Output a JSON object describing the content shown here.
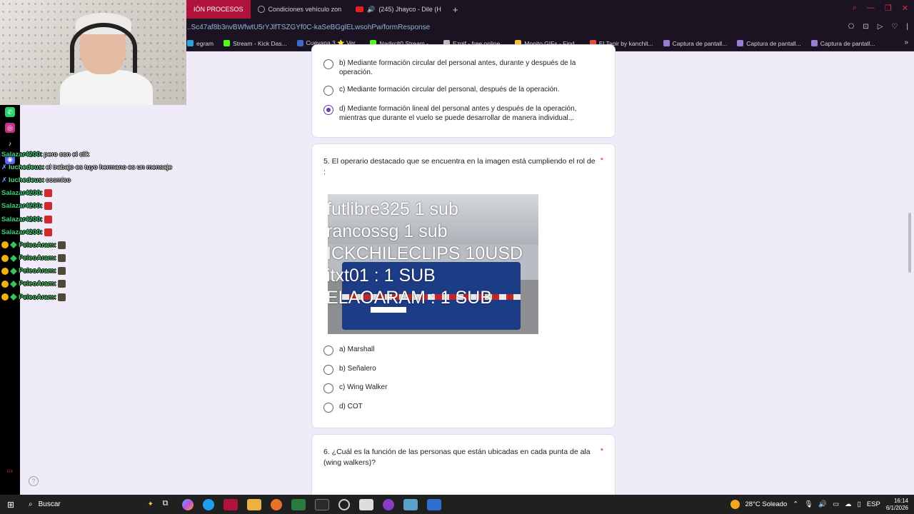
{
  "browser": {
    "tabs": [
      {
        "label": "IÓN PROCESOS",
        "active": true
      },
      {
        "label": "Condiciones vehículo zon",
        "active": false
      },
      {
        "label": "(245) Jhayco - Dile (H",
        "active": false
      }
    ],
    "new_tab": "+",
    "url": "..Sc47af8b3nvBWfwtU5rYJlfTSZGYf0C-kaSeBGglELwsohPw/formResponse",
    "bookmarks": [
      {
        "label": "egram",
        "color": "#2aa3df"
      },
      {
        "label": "Stream - Kick Das...",
        "color": "#53fc18"
      },
      {
        "label": "Cuevana 3 ⭐ Ver...",
        "color": "#3b6cc8"
      },
      {
        "label": "Nadirclt0 Stream -...",
        "color": "#53fc18"
      },
      {
        "label": "Ezgif - free online...",
        "color": "#bbbbbb"
      },
      {
        "label": "Monito GIFs - Find...",
        "color": "#f2c230"
      },
      {
        "label": "El Tapir by kanchit...",
        "color": "#e84c3d"
      },
      {
        "label": "Captura de pantall...",
        "color": "#9a7bd8"
      },
      {
        "label": "Captura de pantall...",
        "color": "#9a7bd8"
      },
      {
        "label": "Captura de pantall...",
        "color": "#9a7bd8"
      }
    ]
  },
  "chat": [
    {
      "user": "Salazar4200:",
      "color": "#38d27a",
      "msg": "pero con el clik",
      "badges": "",
      "emote": ""
    },
    {
      "user": "luchedeus:",
      "color": "#58d88c",
      "msg": "el trabajo es tuyo hermano es un mensaje",
      "badges": "x",
      "emote": ""
    },
    {
      "user": "luchedeus:",
      "color": "#58d88c",
      "msg": "cosmico",
      "badges": "x",
      "emote": ""
    },
    {
      "user": "Salazar4200:",
      "color": "#38d27a",
      "msg": "",
      "badges": "",
      "emote": "#d02a2a"
    },
    {
      "user": "Salazar4200:",
      "color": "#38d27a",
      "msg": "",
      "badges": "",
      "emote": "#d02a2a"
    },
    {
      "user": "Salazar4200:",
      "color": "#38d27a",
      "msg": "",
      "badges": "",
      "emote": "#d02a2a"
    },
    {
      "user": "Salazar4200:",
      "color": "#38d27a",
      "msg": "",
      "badges": "",
      "emote": "#d02a2a"
    },
    {
      "user": "PeleoAram:",
      "color": "#4fc86b",
      "msg": "",
      "badges": "sub",
      "emote": "#4d4a3a"
    },
    {
      "user": "PeleoAram:",
      "color": "#4fc86b",
      "msg": "",
      "badges": "sub",
      "emote": "#4d4a3a"
    },
    {
      "user": "PeleoAram:",
      "color": "#4fc86b",
      "msg": "",
      "badges": "sub",
      "emote": "#4d4a3a"
    },
    {
      "user": "PeleoAram:",
      "color": "#4fc86b",
      "msg": "",
      "badges": "sub",
      "emote": "#4d4a3a"
    },
    {
      "user": "PeleoAram:",
      "color": "#4fc86b",
      "msg": "",
      "badges": "sub",
      "emote": "#4d4a3a"
    }
  ],
  "form": {
    "q4_options": [
      {
        "text": "b) Mediante formación circular del personal antes, durante y después de la operación.",
        "checked": false
      },
      {
        "text": "c)  Mediante formación circular del personal, después de la operación.",
        "checked": false
      },
      {
        "text": "d)  Mediante formación lineal del personal antes y después de la operación, mientras que durante el vuelo se puede desarrollar de manera individual.,.",
        "checked": true
      }
    ],
    "q5": {
      "title": "5. El operario destacado que se encuentra en la imagen está cumpliendo el rol de :",
      "required_mark": "*",
      "overlay_lines": [
        "futlibre325 1 sub",
        "rancossg 1 sub",
        "ICKCHILECLIPS 10USD",
        "itxt01 : 1 SUB",
        "ELAOARAM : 1 SUB"
      ],
      "options": [
        "a) Marshall",
        "b) Señalero",
        "c) Wing Walker",
        "d) COT"
      ]
    },
    "q6": {
      "title": "6. ¿Cuál es la función de las personas que están ubicadas en cada punta de ala (wing walkers)?",
      "required_mark": "*"
    }
  },
  "taskbar": {
    "search_placeholder": "Buscar",
    "weather": "28°C  Soleado",
    "lang": "ESP",
    "time": "16:14",
    "date": "6/1/2026"
  }
}
